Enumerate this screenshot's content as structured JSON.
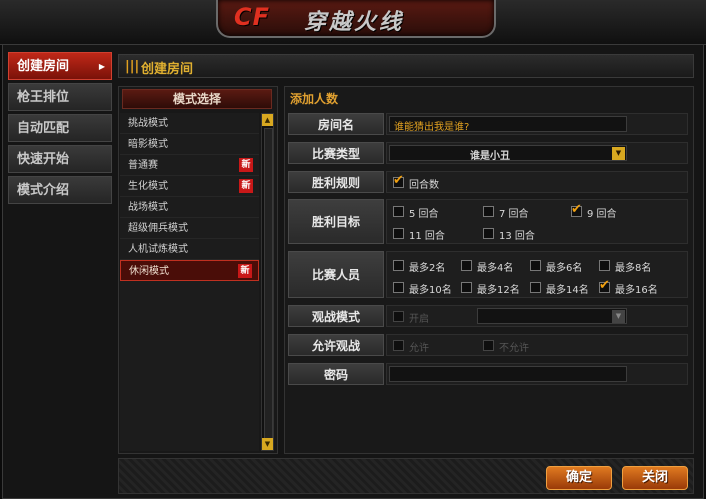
{
  "header": {
    "logo": "CF",
    "game_title": "穿越火线"
  },
  "nav": {
    "items": [
      {
        "label": "创建房间",
        "active": true
      },
      {
        "label": "枪王排位"
      },
      {
        "label": "自动匹配"
      },
      {
        "label": "快速开始"
      },
      {
        "label": "模式介绍"
      }
    ]
  },
  "page": {
    "title": "创建房间"
  },
  "modes": {
    "header": "模式选择",
    "items": [
      {
        "label": "挑战模式",
        "badge": ""
      },
      {
        "label": "暗影模式",
        "badge": ""
      },
      {
        "label": "普通赛",
        "badge": "新"
      },
      {
        "label": "生化模式",
        "badge": "新"
      },
      {
        "label": "战场模式",
        "badge": ""
      },
      {
        "label": "超级佣兵模式",
        "badge": ""
      },
      {
        "label": "人机试炼模式",
        "badge": ""
      },
      {
        "label": "休闲模式",
        "badge": "新",
        "selected": true
      }
    ]
  },
  "form": {
    "section_title": "添加人数",
    "room_name": {
      "label": "房间名",
      "value": "谁能猜出我是谁?"
    },
    "match_type": {
      "label": "比赛类型",
      "value": "谁是小丑"
    },
    "win_rule": {
      "label": "胜利规则",
      "option": "回合数",
      "checked": true
    },
    "win_target": {
      "label": "胜利目标",
      "options": [
        {
          "label": "5 回合",
          "checked": false
        },
        {
          "label": "7 回合",
          "checked": false
        },
        {
          "label": "9 回合",
          "checked": true
        },
        {
          "label": "11 回合",
          "checked": false
        },
        {
          "label": "13 回合",
          "checked": false
        }
      ]
    },
    "players": {
      "label": "比赛人员",
      "options": [
        {
          "label": "最多2名",
          "checked": false
        },
        {
          "label": "最多4名",
          "checked": false
        },
        {
          "label": "最多6名",
          "checked": false
        },
        {
          "label": "最多8名",
          "checked": false
        },
        {
          "label": "最多10名",
          "checked": false
        },
        {
          "label": "最多12名",
          "checked": false
        },
        {
          "label": "最多14名",
          "checked": false
        },
        {
          "label": "最多16名",
          "checked": true
        }
      ]
    },
    "spectate_mode": {
      "label": "观战模式",
      "option": "开启",
      "dropdown_value": ""
    },
    "allow_spectate": {
      "label": "允许观战",
      "allow": "允许",
      "deny": "不允许"
    },
    "password": {
      "label": "密码",
      "value": ""
    }
  },
  "buttons": {
    "confirm": "确定",
    "close": "关闭"
  },
  "colors": {
    "accent": "#c02818",
    "gold": "#e0a030",
    "check": "#f0a010"
  }
}
